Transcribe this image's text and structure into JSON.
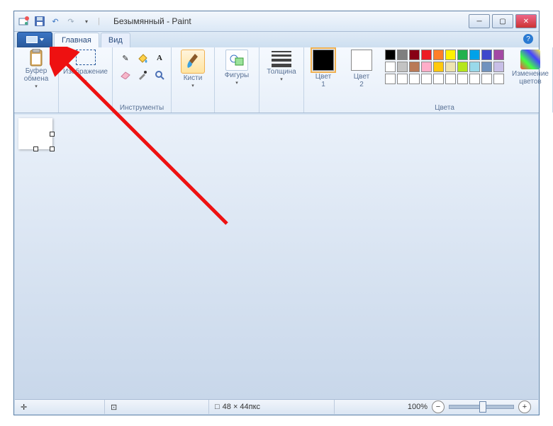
{
  "window": {
    "title": "Безымянный - Paint"
  },
  "qat": {
    "icons": [
      "paint",
      "save",
      "undo",
      "redo",
      "customize"
    ]
  },
  "tabs": {
    "file": "",
    "main": "Главная",
    "view": "Вид"
  },
  "ribbon": {
    "clipboard": {
      "label": "Буфер\nобмена"
    },
    "image": {
      "label": "Изображение"
    },
    "tools": {
      "label": "Инструменты"
    },
    "brushes": {
      "label": "Кисти"
    },
    "shapes": {
      "label": "Фигуры"
    },
    "thickness": {
      "label": "Толщина"
    },
    "color1": {
      "label": "Цвет\n1"
    },
    "color2": {
      "label": "Цвет\n2"
    },
    "colors_group": "Цвета",
    "edit_colors": {
      "label": "Изменение\nцветов"
    }
  },
  "palette": [
    "#000000",
    "#7f7f7f",
    "#880015",
    "#ed1c24",
    "#ff7f27",
    "#fff200",
    "#22b14c",
    "#00a2e8",
    "#3f48cc",
    "#a349a4",
    "#ffffff",
    "#c3c3c3",
    "#b97a57",
    "#ffaec9",
    "#ffc90e",
    "#efe4b0",
    "#b5e61d",
    "#99d9ea",
    "#7092be",
    "#c8bfe7",
    "#ffffff",
    "#ffffff",
    "#ffffff",
    "#ffffff",
    "#ffffff",
    "#ffffff",
    "#ffffff",
    "#ffffff",
    "#ffffff",
    "#ffffff"
  ],
  "status": {
    "coords": "",
    "selection": "",
    "canvas_size": "48 × 44пкс",
    "zoom": "100%"
  }
}
